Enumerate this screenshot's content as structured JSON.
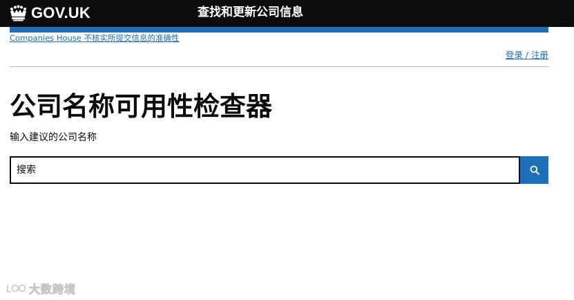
{
  "header": {
    "logo_text": "GOV.UK",
    "service_name": "查找和更新公司信息",
    "background_color": "#0b0c0c",
    "accent_color": "#1d70b8",
    "logo_icon": "crown-icon"
  },
  "notice": {
    "text": "Companies House 不核实所提交信息的准确性"
  },
  "account": {
    "signin_label": "登录 / 注册"
  },
  "main": {
    "title": "公司名称可用性检查器",
    "hint": "输入建议的公司名称",
    "search": {
      "placeholder": "搜索",
      "value": "",
      "button_icon": "search-icon"
    }
  },
  "watermark": {
    "text": "大数跨境",
    "icon": "watermark-logo-icon"
  }
}
